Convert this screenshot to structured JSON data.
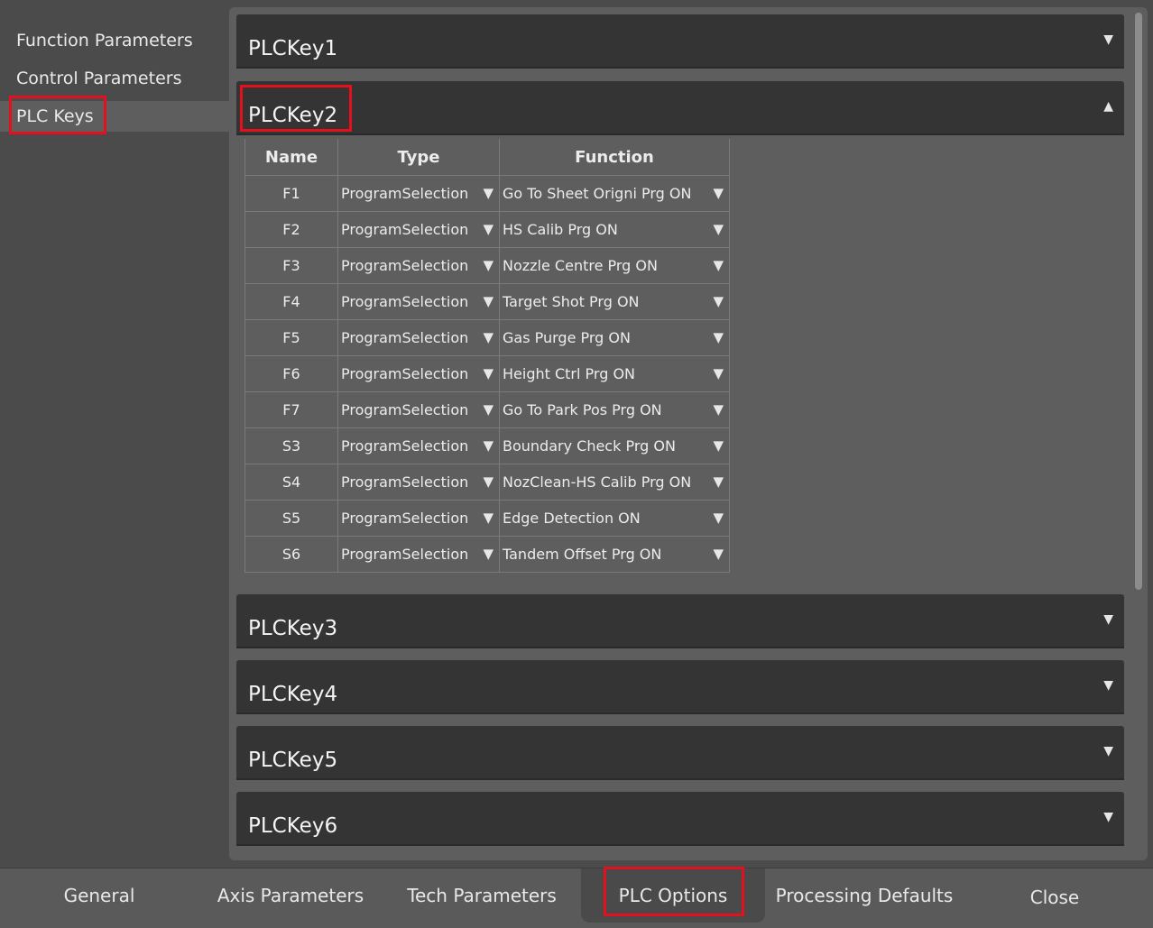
{
  "sidebar": {
    "items": [
      {
        "label": "Function Parameters"
      },
      {
        "label": "Control Parameters"
      },
      {
        "label": "PLC Keys",
        "selected": true
      }
    ]
  },
  "plc_keys": [
    {
      "title": "PLCKey1",
      "expanded": false,
      "icon": "chevron-down-icon"
    },
    {
      "title": "PLCKey2",
      "expanded": true,
      "icon": "chevron-up-icon"
    },
    {
      "title": "PLCKey3",
      "expanded": false,
      "icon": "chevron-down-icon"
    },
    {
      "title": "PLCKey4",
      "expanded": false,
      "icon": "chevron-down-icon"
    },
    {
      "title": "PLCKey5",
      "expanded": false,
      "icon": "chevron-down-icon"
    },
    {
      "title": "PLCKey6",
      "expanded": false,
      "icon": "chevron-down-icon"
    }
  ],
  "table": {
    "headers": {
      "name": "Name",
      "type": "Type",
      "function": "Function"
    },
    "rows": [
      {
        "name": "F1",
        "type": "ProgramSelection",
        "function": "Go To Sheet Origni Prg ON"
      },
      {
        "name": "F2",
        "type": "ProgramSelection",
        "function": "HS Calib Prg ON"
      },
      {
        "name": "F3",
        "type": "ProgramSelection",
        "function": "Nozzle Centre Prg ON"
      },
      {
        "name": "F4",
        "type": "ProgramSelection",
        "function": "Target Shot Prg ON"
      },
      {
        "name": "F5",
        "type": "ProgramSelection",
        "function": "Gas Purge Prg ON"
      },
      {
        "name": "F6",
        "type": "ProgramSelection",
        "function": "Height Ctrl Prg ON"
      },
      {
        "name": "F7",
        "type": "ProgramSelection",
        "function": "Go To Park Pos Prg ON"
      },
      {
        "name": "S3",
        "type": "ProgramSelection",
        "function": "Boundary Check Prg ON"
      },
      {
        "name": "S4",
        "type": "ProgramSelection",
        "function": "NozClean-HS Calib Prg ON"
      },
      {
        "name": "S5",
        "type": "ProgramSelection",
        "function": "Edge Detection ON"
      },
      {
        "name": "S6",
        "type": "ProgramSelection",
        "function": "Tandem Offset Prg ON"
      }
    ]
  },
  "bottom_tabs": [
    {
      "label": "General"
    },
    {
      "label": "Axis Parameters"
    },
    {
      "label": "Tech Parameters"
    },
    {
      "label": "PLC Options",
      "selected": true
    },
    {
      "label": "Processing Defaults"
    },
    {
      "label": "Close"
    }
  ],
  "colors": {
    "highlight": "#e4101d",
    "header_bg": "#343434",
    "panel_bg": "#5e5e5e",
    "background": "#4b4b4b"
  }
}
